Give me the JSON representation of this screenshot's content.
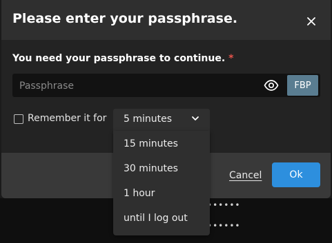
{
  "dialog": {
    "title": "Please enter your passphrase.",
    "prompt": "You need your passphrase to continue.",
    "required_marker": "*",
    "passphrase": {
      "placeholder": "Passphrase",
      "value": ""
    },
    "fingerprint_badge": "FBP",
    "remember": {
      "label": "Remember it for",
      "checked": false
    },
    "cancel_label": "Cancel",
    "ok_label": "Ok"
  },
  "duration_select": {
    "selected": "5 minutes",
    "options": [
      "15 minutes",
      "30 minutes",
      "1 hour",
      "until I log out"
    ]
  },
  "background": {
    "masked_1": "••••••",
    "masked_2": "••••••"
  },
  "colors": {
    "primary_button": "#2d8fde",
    "fingerprint_badge": "#5a7d91",
    "required": "#e5534b",
    "dialog_header": "#2f2f2f",
    "dialog_body": "#232323",
    "dialog_footer": "#393939"
  },
  "icons": {
    "close": "close-icon",
    "reveal_password": "eye-icon",
    "dropdown": "chevron-down-icon"
  }
}
